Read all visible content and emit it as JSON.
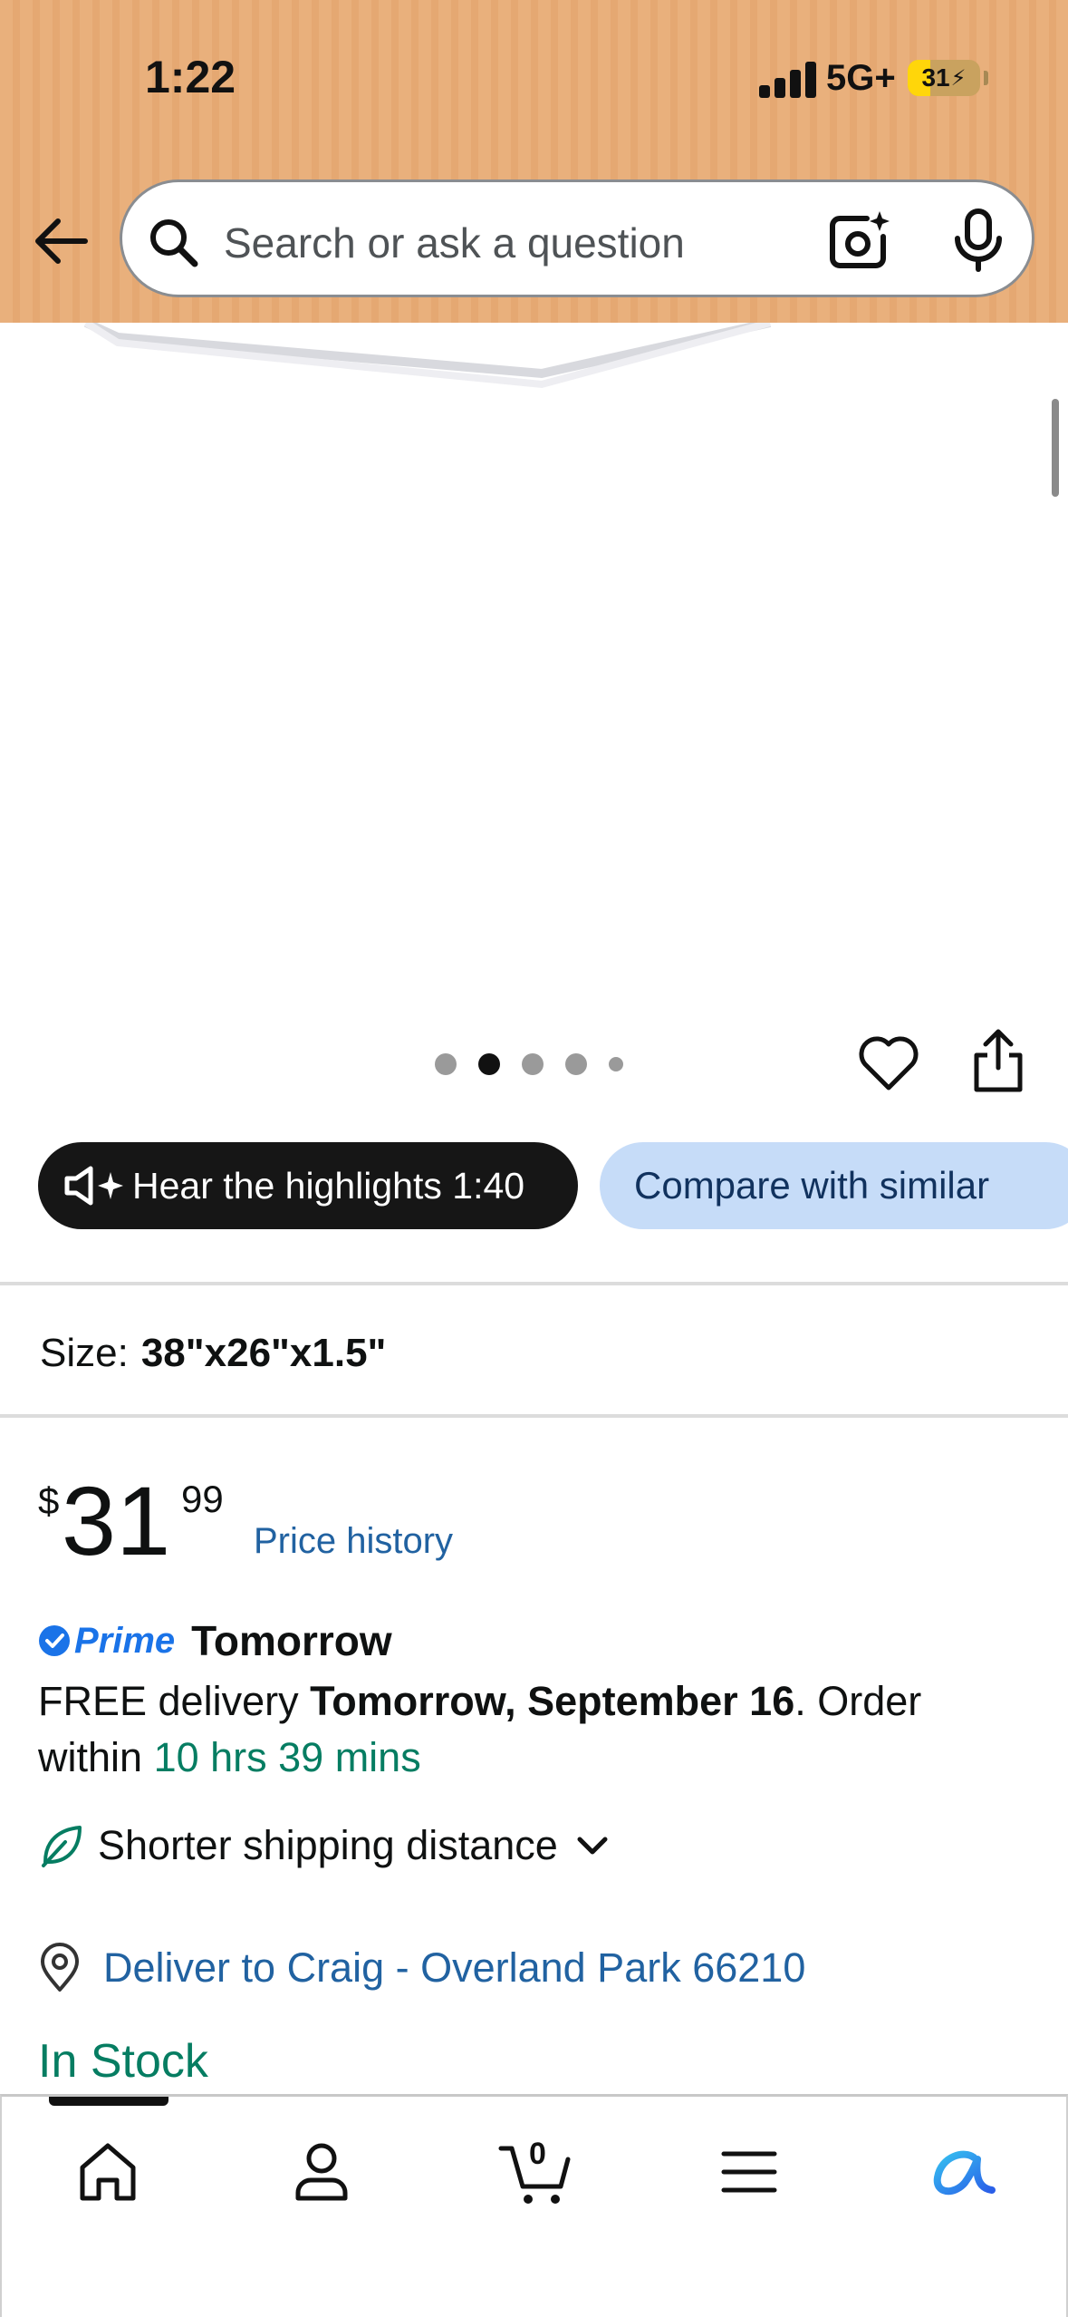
{
  "status_bar": {
    "time": "1:22",
    "network": "5G+",
    "battery": "31",
    "battery_level": 0.31
  },
  "header": {
    "search_placeholder": "Search or ask a question",
    "icons": [
      "back-arrow-icon",
      "search-icon",
      "camera-icon",
      "mic-icon"
    ]
  },
  "gallery": {
    "dot_count": 5,
    "active_dot": 2,
    "icons": [
      "heart-icon",
      "share-icon"
    ]
  },
  "actions": {
    "hear_label": "Hear the highlights 1:40",
    "compare_label": "Compare with similar"
  },
  "size": {
    "label": "Size:",
    "value": "38\"x26\"x1.5\""
  },
  "price": {
    "currency": "$",
    "whole": "31",
    "fraction": "99",
    "history_link": "Price history"
  },
  "delivery": {
    "prime_label": "Prime",
    "prime_day": "Tomorrow",
    "line_prefix": "FREE delivery ",
    "line_date": "Tomorrow, September 16",
    "line_mid": ". Order within ",
    "line_countdown": "10 hrs 39 mins",
    "shipping_note": "Shorter shipping distance",
    "deliver_to": "Deliver to Craig - Overland Park 66210",
    "stock_status": "In Stock"
  },
  "colors": {
    "header_bg": "#e9b07c",
    "link_blue": "#2162a1",
    "stock_green": "#067d62",
    "compare_bg": "#c6dcf8",
    "prime_blue": "#1a73e8"
  },
  "bottom_nav": {
    "cart_count": "0",
    "tabs": [
      "home-icon",
      "account-icon",
      "cart-icon",
      "menu-icon",
      "rufus-ai-icon"
    ]
  }
}
